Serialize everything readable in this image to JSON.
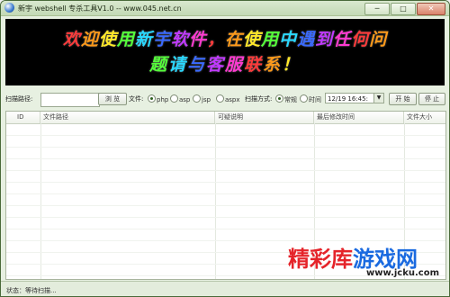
{
  "window": {
    "title": "新宇 webshell 专杀工具V1.0  -- www.045.net.cn",
    "minimize_glyph": "─",
    "maximize_glyph": "□",
    "close_glyph": "✕"
  },
  "banner": {
    "line1": [
      "欢",
      "迎",
      "使",
      "用",
      "新",
      "宇",
      "软",
      "件",
      "，",
      "在",
      "使",
      "用",
      "中",
      "遇",
      "到",
      "任",
      "何",
      "问"
    ],
    "line2": [
      "题",
      "请",
      "与",
      "客",
      "服",
      "联",
      "系",
      "！"
    ],
    "colors": [
      "#ff3b3b",
      "#ff9a1a",
      "#ffe82a",
      "#55ff3a",
      "#2ad8ff",
      "#3a6aff",
      "#c03aff",
      "#ff3ad1"
    ]
  },
  "toolbar": {
    "path_label": "扫描路径:",
    "path_value": "",
    "browse_label": "浏 览",
    "file_label": "文件:",
    "file_types": [
      {
        "label": "php",
        "checked": true
      },
      {
        "label": "asp",
        "checked": false
      },
      {
        "label": "jsp",
        "checked": false
      },
      {
        "label": "aspx",
        "checked": false
      }
    ],
    "scan_mode_label": "扫描方式:",
    "scan_modes": [
      {
        "label": "常规",
        "checked": true
      },
      {
        "label": "时间",
        "checked": false
      }
    ],
    "date_value": "12/19 16:45:",
    "start_label": "开 始",
    "stop_label": "停 止"
  },
  "table": {
    "columns": [
      "ID",
      "文件路径",
      "可疑说明",
      "最后修改时间",
      "文件大小"
    ],
    "rows": []
  },
  "status": {
    "text": "状态：等待扫描..."
  },
  "watermark": {
    "part1": "精彩库",
    "part2": "游戏网",
    "sub": "www.jcku.com"
  }
}
